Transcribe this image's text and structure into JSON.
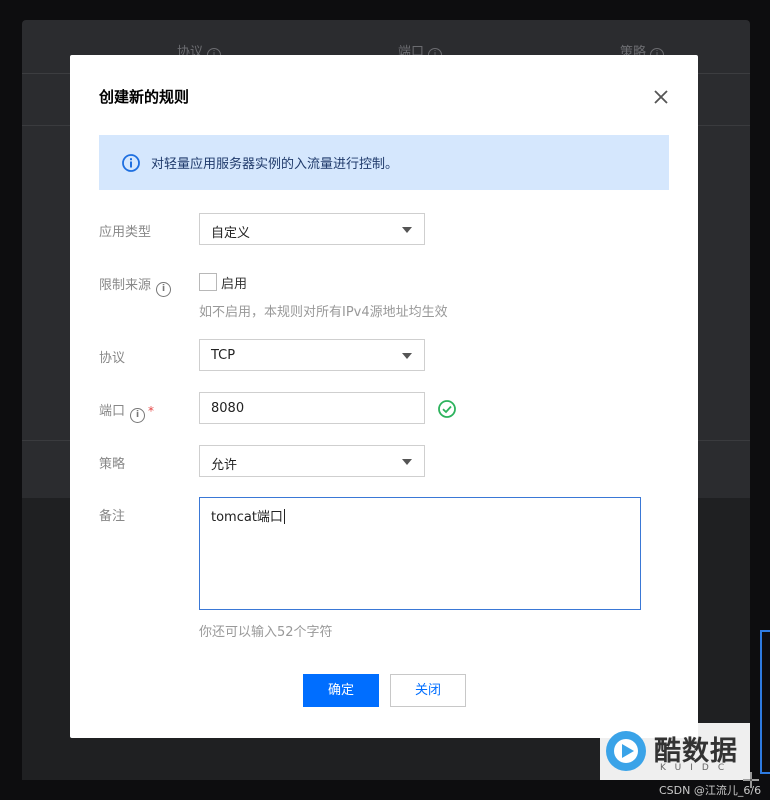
{
  "background": {
    "columns": [
      {
        "label": "协议"
      },
      {
        "label": "端口"
      },
      {
        "label": "策略"
      }
    ]
  },
  "dialog": {
    "title": "创建新的规则",
    "close_icon": "close-icon",
    "notice": "对轻量应用服务器实例的入流量进行控制。",
    "fields": {
      "app_type": {
        "label": "应用类型",
        "value": "自定义"
      },
      "source_limit": {
        "label": "限制来源",
        "checkbox_label": "启用",
        "checked": false,
        "hint": "如不启用，本规则对所有IPv4源地址均生效"
      },
      "protocol": {
        "label": "协议",
        "value": "TCP"
      },
      "port": {
        "label": "端口",
        "value": "8080",
        "required": "*",
        "valid": true
      },
      "policy": {
        "label": "策略",
        "value": "允许"
      },
      "remark": {
        "label": "备注",
        "value": "tomcat端口",
        "hint": "你还可以输入52个字符"
      }
    },
    "buttons": {
      "confirm": "确定",
      "close": "关闭"
    }
  },
  "watermark": {
    "logo_text": "酷数据",
    "logo_sub": "KUIDC",
    "credit": "CSDN @江流儿_6/6"
  },
  "colors": {
    "primary": "#006eff",
    "notice_bg": "#d5e7fd",
    "success": "#2db35d",
    "required": "#e54545"
  }
}
